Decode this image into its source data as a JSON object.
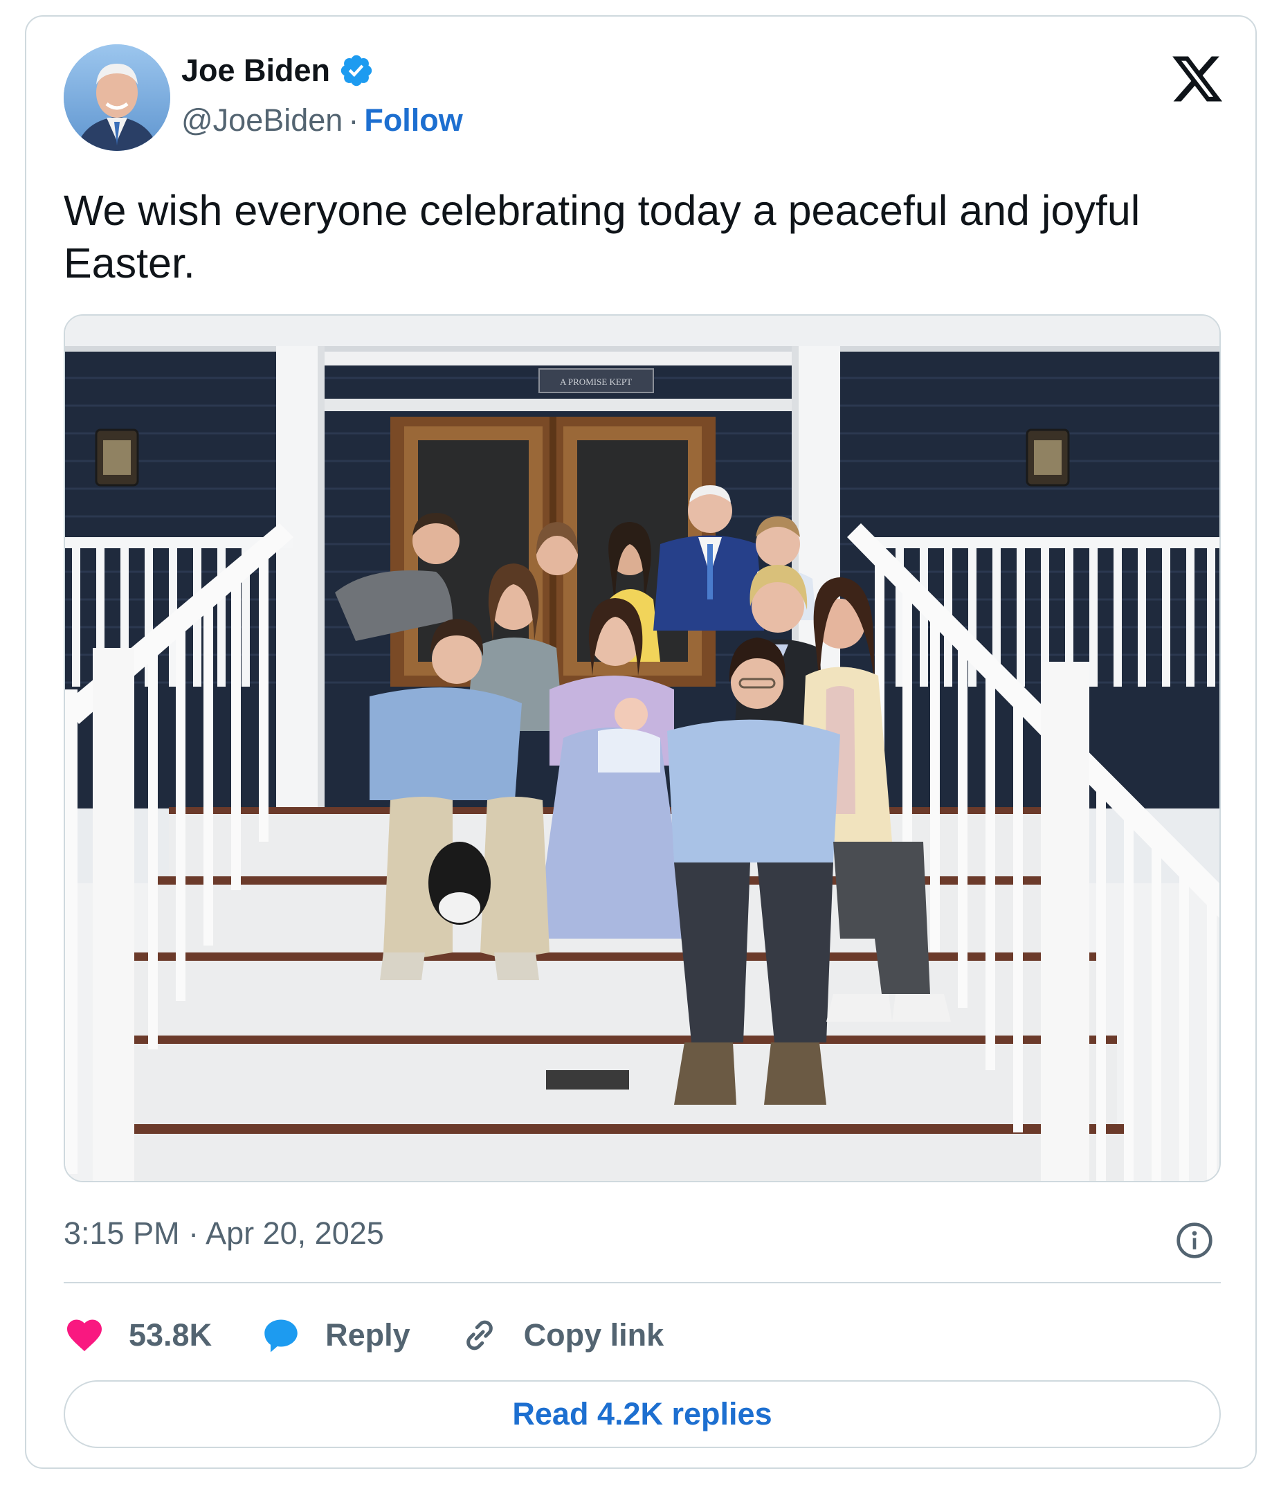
{
  "tweet": {
    "author_name": "Joe Biden",
    "handle": "@JoeBiden",
    "separator": "·",
    "follow_label": "Follow",
    "text": "We wish everyone celebrating today a peaceful and joyful Easter.",
    "photo_sign_text": "A PROMISE KEPT",
    "timestamp": "3:15 PM · Apr 20, 2025"
  },
  "actions": {
    "likes_count": "53.8K",
    "reply_label": "Reply",
    "copy_link_label": "Copy link"
  },
  "read_replies_label": "Read 4.2K replies",
  "icons": {
    "verified": "verified-badge-icon",
    "platform": "x-logo-icon",
    "info": "info-icon",
    "like": "heart-icon",
    "reply": "speech-bubble-icon",
    "copy": "link-icon"
  },
  "colors": {
    "accent": "#1d6fd0",
    "heart": "#f91880",
    "muted": "#536471",
    "border": "#cfd9de"
  }
}
